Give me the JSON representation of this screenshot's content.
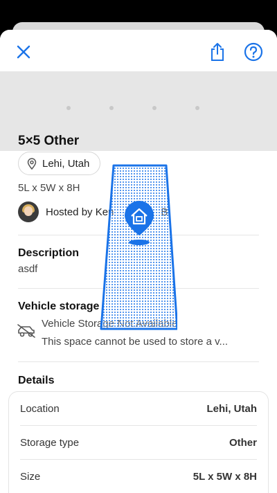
{
  "header": {
    "close_icon": "close-icon",
    "share_icon": "share-icon",
    "help_icon": "help-icon",
    "accent_color": "#1a73e8"
  },
  "listing": {
    "title": "5×5 Other",
    "location": "Lehi, Utah",
    "dimensions": "5L x 5W x 8H",
    "host": "Hosted by Ken",
    "host_trailing": "B."
  },
  "description": {
    "heading": "Description",
    "text": "asdf"
  },
  "vehicle_storage": {
    "heading": "Vehicle storage",
    "status": "Vehicle Storage Not Available",
    "note": "This space cannot be used to store a v..."
  },
  "details": {
    "heading": "Details",
    "rows": [
      {
        "label": "Location",
        "value": "Lehi, Utah"
      },
      {
        "label": "Storage type",
        "value": "Other"
      },
      {
        "label": "Size",
        "value": "5L x 5W x 8H"
      }
    ]
  }
}
